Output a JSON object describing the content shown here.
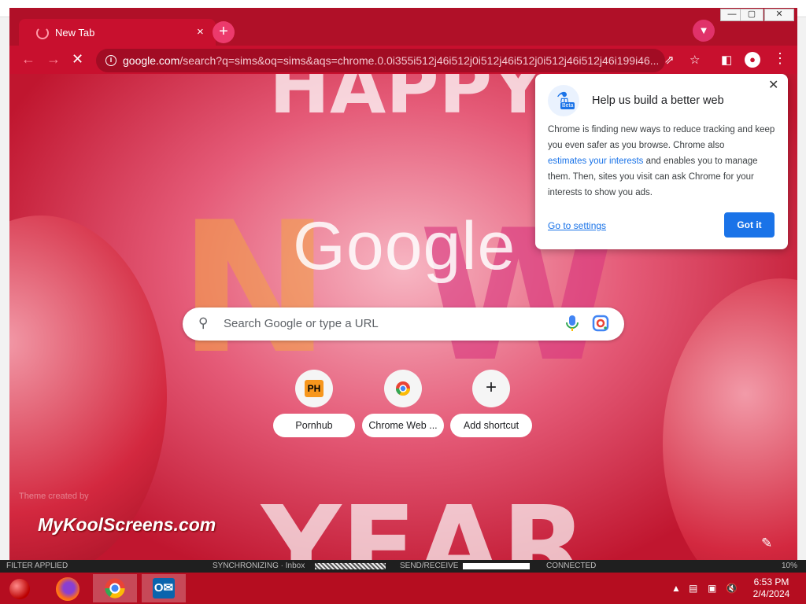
{
  "browser": {
    "tab_title": "New Tab",
    "tab_close": "×",
    "new_tab": "+",
    "url_host": "google.com",
    "url_rest": "/search?q=sims&oq=sims&aqs=chrome.0.0i355i512j46i512j0i512j46i512j0i512j46i512j46i199i46..."
  },
  "ntp": {
    "logo_text": "Google",
    "search_placeholder": "Search Google or type a URL",
    "shortcuts": [
      {
        "icon_text": "PH",
        "label": "Pornhub"
      },
      {
        "icon_text": "",
        "label": "Chrome Web ..."
      },
      {
        "icon_text": "+",
        "label": "Add shortcut"
      }
    ],
    "theme_credit": "Theme created by",
    "watermark": "MyKoolScreens.com"
  },
  "popup": {
    "icon_badge": "Beta",
    "title": "Help us build a better web",
    "body_1": "Chrome is finding new ways to reduce tracking and keep you even safer as you browse. Chrome also",
    "body_link": "estimates your interests",
    "body_2": "and enables you to manage them. Then, sites you visit can ask Chrome for your interests to show you ads.",
    "go_to_settings": "Go to settings",
    "got_it": "Got it"
  },
  "statusbar": {
    "filter": "FILTER APPLIED",
    "sync": "SYNCHRONIZING · Inbox",
    "send": "SEND/RECEIVE",
    "connected": "CONNECTED",
    "zoom": "10%"
  },
  "taskbar": {
    "time": "6:53 PM",
    "date": "2/4/2024"
  },
  "colors": {
    "accent": "#1a73e8",
    "theme": "#c8102e"
  }
}
